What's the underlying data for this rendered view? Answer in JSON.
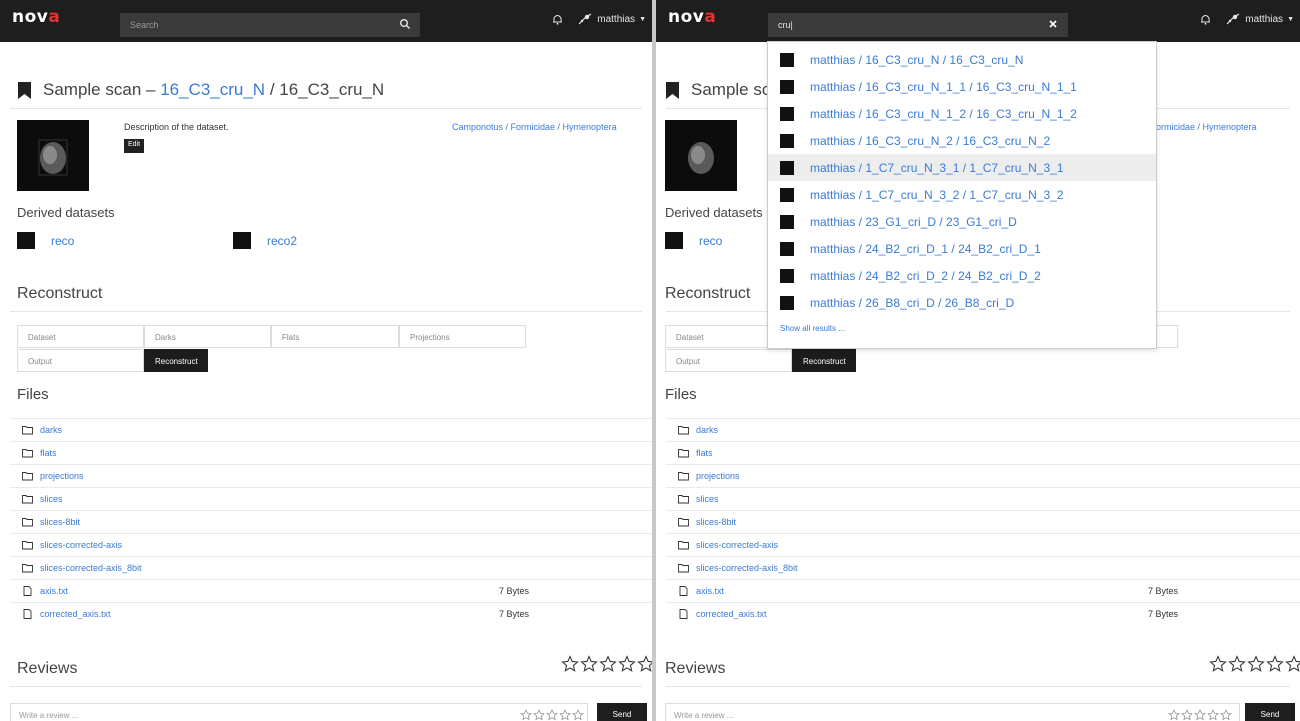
{
  "brand": {
    "logo_text": "nov",
    "logo_accent": "a"
  },
  "colors": {
    "link": "#3a7bd5",
    "navbar": "#1e1e1e",
    "accent": "#e2342e"
  },
  "left": {
    "search": {
      "placeholder": "Search"
    },
    "user": {
      "name": "matthias"
    },
    "title": {
      "prefix": "Sample scan – ",
      "link": "16_C3_cru_N",
      "rest": " / 16_C3_cru_N"
    },
    "description": "Description of the dataset.",
    "edit_label": "Edit",
    "taxonomy": "Camponotus / Formicidae / Hymenoptera",
    "derived": {
      "heading": "Derived datasets",
      "items": [
        "reco",
        "reco2"
      ]
    },
    "reconstruct": {
      "heading": "Reconstruct",
      "tabs": [
        "Dataset",
        "Darks",
        "Flats",
        "Projections",
        "Output",
        "Reconstruct"
      ]
    },
    "files": {
      "heading": "Files",
      "rows": [
        {
          "name": "darks",
          "type": "folder",
          "size": ""
        },
        {
          "name": "flats",
          "type": "folder",
          "size": ""
        },
        {
          "name": "projections",
          "type": "folder",
          "size": ""
        },
        {
          "name": "slices",
          "type": "folder",
          "size": ""
        },
        {
          "name": "slices-8bit",
          "type": "folder",
          "size": ""
        },
        {
          "name": "slices-corrected-axis",
          "type": "folder",
          "size": ""
        },
        {
          "name": "slices-corrected-axis_8bit",
          "type": "folder",
          "size": ""
        },
        {
          "name": "axis.txt",
          "type": "file",
          "size": "7 Bytes"
        },
        {
          "name": "corrected_axis.txt",
          "type": "file",
          "size": "7 Bytes"
        }
      ]
    },
    "reviews": {
      "heading": "Reviews",
      "placeholder": "Write a review ...",
      "send_label": "Send"
    }
  },
  "right": {
    "search": {
      "value": "cru"
    },
    "user": {
      "name": "matthias"
    },
    "title": {
      "prefix": "Sample sca"
    },
    "taxonomy_partial": "ormicidae / Hymenoptera",
    "derived": {
      "heading": "Derived datasets",
      "items": [
        "reco"
      ]
    },
    "reconstruct": {
      "heading": "Reconstruct",
      "tabs": [
        "Dataset",
        "Output",
        "Reconstruct"
      ]
    },
    "files": {
      "heading": "Files",
      "rows": [
        {
          "name": "darks",
          "type": "folder",
          "size": ""
        },
        {
          "name": "flats",
          "type": "folder",
          "size": ""
        },
        {
          "name": "projections",
          "type": "folder",
          "size": ""
        },
        {
          "name": "slices",
          "type": "folder",
          "size": ""
        },
        {
          "name": "slices-8bit",
          "type": "folder",
          "size": ""
        },
        {
          "name": "slices-corrected-axis",
          "type": "folder",
          "size": ""
        },
        {
          "name": "slices-corrected-axis_8bit",
          "type": "folder",
          "size": ""
        },
        {
          "name": "axis.txt",
          "type": "file",
          "size": "7 Bytes"
        },
        {
          "name": "corrected_axis.txt",
          "type": "file",
          "size": "7 Bytes"
        }
      ]
    },
    "reviews": {
      "heading": "Reviews",
      "placeholder": "Write a review ...",
      "send_label": "Send"
    },
    "dropdown": {
      "items": [
        {
          "label": "matthias / 16_C3_cru_N / 16_C3_cru_N",
          "highlighted": false
        },
        {
          "label": "matthias / 16_C3_cru_N_1_1 / 16_C3_cru_N_1_1",
          "highlighted": false
        },
        {
          "label": "matthias / 16_C3_cru_N_1_2 / 16_C3_cru_N_1_2",
          "highlighted": false
        },
        {
          "label": "matthias / 16_C3_cru_N_2 / 16_C3_cru_N_2",
          "highlighted": false
        },
        {
          "label": "matthias / 1_C7_cru_N_3_1 / 1_C7_cru_N_3_1",
          "highlighted": true
        },
        {
          "label": "matthias / 1_C7_cru_N_3_2 / 1_C7_cru_N_3_2",
          "highlighted": false
        },
        {
          "label": "matthias / 23_G1_cri_D / 23_G1_cri_D",
          "highlighted": false
        },
        {
          "label": "matthias / 24_B2_cri_D_1 / 24_B2_cri_D_1",
          "highlighted": false
        },
        {
          "label": "matthias / 24_B2_cri_D_2 / 24_B2_cri_D_2",
          "highlighted": false
        },
        {
          "label": "matthias / 26_B8_cri_D / 26_B8_cri_D",
          "highlighted": false
        }
      ],
      "show_all": "Show all results ..."
    }
  }
}
